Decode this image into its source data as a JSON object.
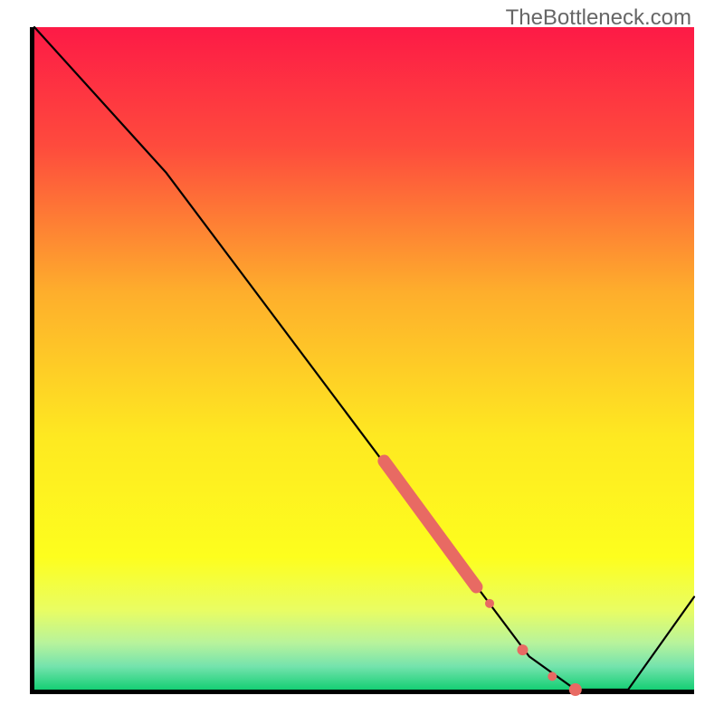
{
  "watermark": "TheBottleneck.com",
  "chart_data": {
    "type": "line",
    "title": "",
    "xlabel": "",
    "ylabel": "",
    "xlim": [
      0,
      100
    ],
    "ylim": [
      0,
      100
    ],
    "x": [
      0,
      20,
      75,
      82,
      90,
      100
    ],
    "values": [
      100,
      78,
      5,
      0,
      0,
      14
    ],
    "highlight_segment": {
      "x": [
        53,
        67,
        74,
        78.5,
        82
      ],
      "y": [
        34.5,
        15.5,
        6,
        2,
        0
      ],
      "color": "#e86a63",
      "style": "thick_with_dots"
    },
    "background_gradient": {
      "type": "vertical",
      "stops": [
        {
          "pos": 0.0,
          "color": "#fd1a46"
        },
        {
          "pos": 0.18,
          "color": "#fe4b3d"
        },
        {
          "pos": 0.4,
          "color": "#feae2c"
        },
        {
          "pos": 0.62,
          "color": "#fee921"
        },
        {
          "pos": 0.8,
          "color": "#fdfe1e"
        },
        {
          "pos": 0.88,
          "color": "#e9fd63"
        },
        {
          "pos": 0.93,
          "color": "#b7f39c"
        },
        {
          "pos": 0.965,
          "color": "#74e3ad"
        },
        {
          "pos": 1.0,
          "color": "#15cf74"
        }
      ]
    }
  }
}
